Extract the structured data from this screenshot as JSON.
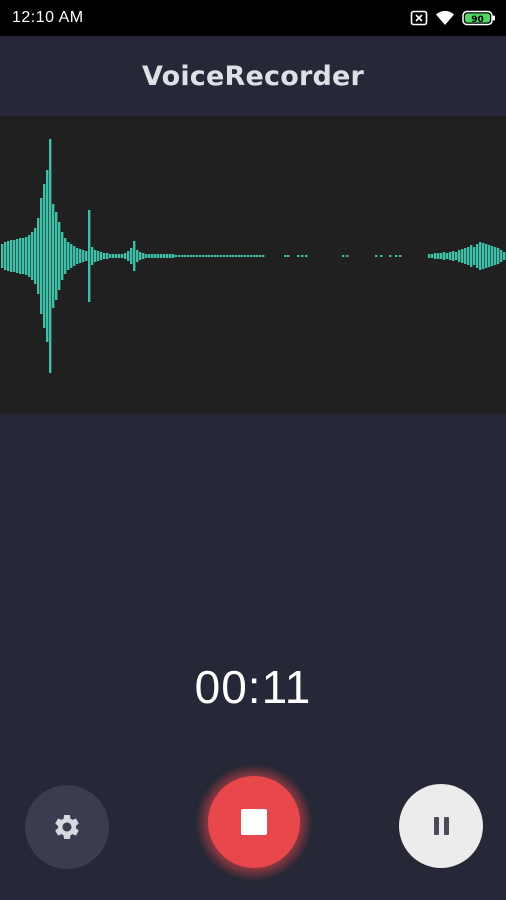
{
  "status_bar": {
    "time": "12:10 AM",
    "icons": [
      "sim-icon",
      "wifi-icon",
      "battery-icon"
    ],
    "battery_level": 0.9
  },
  "app": {
    "title": "VoiceRecorder"
  },
  "recorder": {
    "elapsed": "00:11",
    "waveform_color": "#3ec0a8"
  },
  "controls": {
    "settings_icon": "gear-icon",
    "record_icon": "stop-icon",
    "pause_icon": "pause-icon",
    "record_color": "#e8484c"
  }
}
